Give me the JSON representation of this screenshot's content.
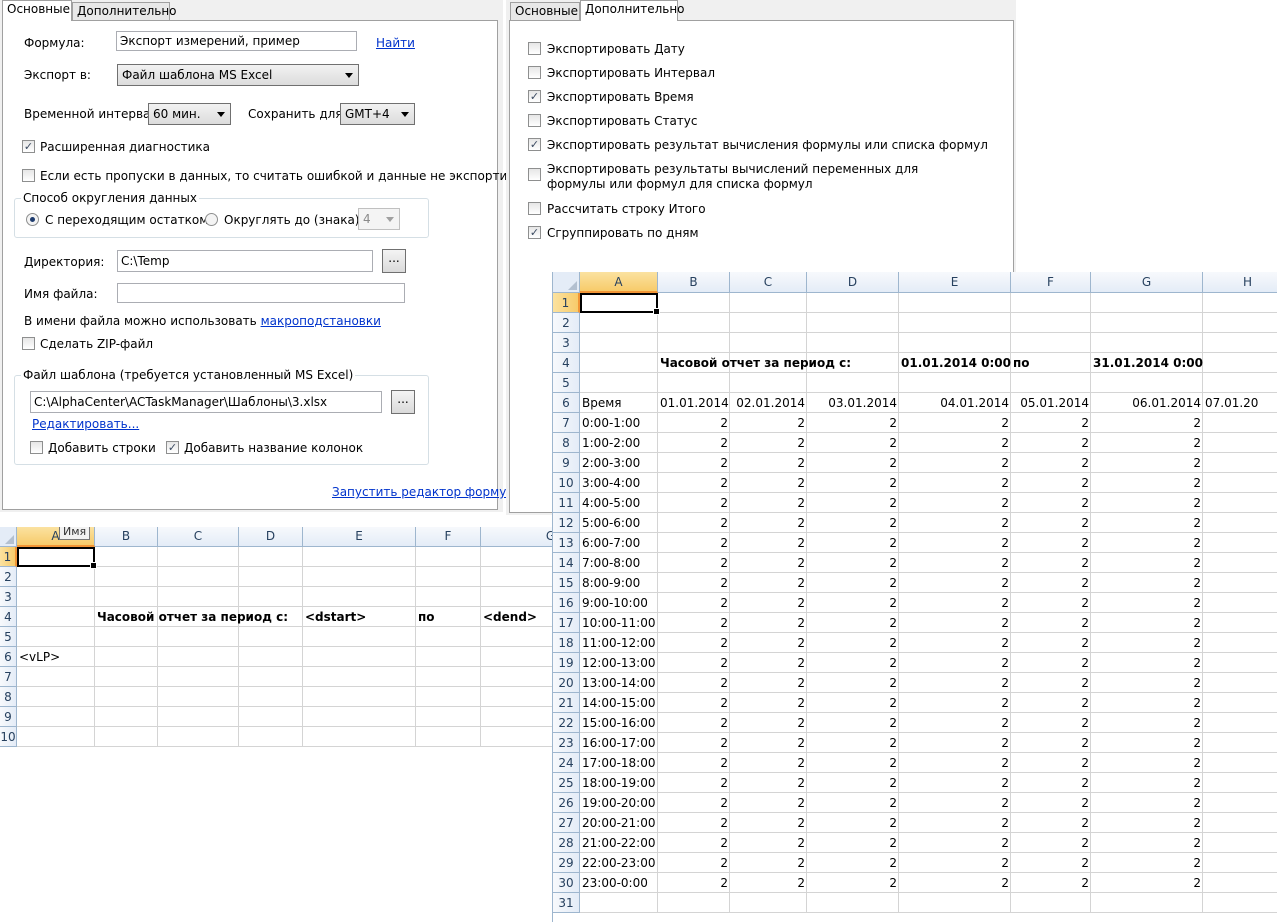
{
  "left_dialog": {
    "tabs": [
      "Основные",
      "Дополнительно"
    ],
    "formula_label": "Формула:",
    "formula_value": "Экспорт измерений, пример",
    "find_link": "Найти",
    "export_label": "Экспорт в:",
    "export_value": "Файл шаблона MS Excel",
    "interval_label": "Временной интервал:",
    "interval_value": "60 мин.",
    "save_for_label": "Сохранить для:",
    "save_for_value": "GMT+4",
    "ext_diag_label": "Расширенная диагностика",
    "ext_diag_checked": true,
    "gaps_label": "Если есть пропуски в данных, то считать ошибкой и данные не экспортировать",
    "gaps_checked": false,
    "rounding_group": "Способ округления данных",
    "rounding_carry_label": "С переходящим остатком",
    "rounding_carry_selected": true,
    "rounding_digits_label": "Округлять до (знака)",
    "rounding_digits_value": "4",
    "dir_label": "Директория:",
    "dir_value": "C:\\Temp",
    "browse_label": "...",
    "filename_label": "Имя файла:",
    "filename_value": "",
    "macro_hint": "В имени файла можно использовать",
    "macro_link": "макроподстановки",
    "zip_label": "Сделать ZIP-файл",
    "zip_checked": false,
    "template_group": "Файл шаблона (требуется установленный MS Excel)",
    "template_path": "C:\\AlphaCenter\\ACTaskManager\\Шаблоны\\3.xlsx",
    "edit_link": "Редактировать...",
    "add_rows_label": "Добавить строки",
    "add_rows_checked": false,
    "add_colnames_label": "Добавить название колонок",
    "add_colnames_checked": true,
    "formula_editor_link": "Запустить редактор формул"
  },
  "right_dialog": {
    "tabs": [
      "Основные",
      "Дополнительно"
    ],
    "options": [
      {
        "label": "Экспортировать Дату",
        "checked": false
      },
      {
        "label": "Экспортировать Интервал",
        "checked": false
      },
      {
        "label": "Экспортировать Время",
        "checked": true
      },
      {
        "label": "Экспортировать Статус",
        "checked": false
      },
      {
        "label": "Экспортировать результат вычисления формулы или списка формул",
        "checked": true
      },
      {
        "label": "Экспортировать результаты вычислений переменных для",
        "label2": "формулы или формул для списка формул",
        "checked": false
      },
      {
        "label": "Рассчитать строку Итого",
        "checked": false
      },
      {
        "label": "Сгруппировать по дням",
        "checked": true
      }
    ]
  },
  "template_sheet": {
    "tooltip": "Имя",
    "columns": [
      "A",
      "B",
      "C",
      "D",
      "E",
      "F",
      "G"
    ],
    "rows": [
      "1",
      "2",
      "3",
      "4",
      "5",
      "6",
      "7",
      "8",
      "9",
      "10"
    ],
    "title": "Часовой отчет за период с:",
    "dstart": "<dstart>",
    "po": "по",
    "dend": "<dend>",
    "vlp": "<vLP>"
  },
  "result_sheet": {
    "columns": [
      "A",
      "B",
      "C",
      "D",
      "E",
      "F",
      "G",
      "H"
    ],
    "title": "Часовой отчет за период с:",
    "date_from": "01.01.2014 0:00",
    "po": "по",
    "date_to": "31.01.2014 0:00",
    "time_header": "Время",
    "dates": [
      "01.01.2014",
      "02.01.2014",
      "03.01.2014",
      "04.01.2014",
      "05.01.2014",
      "06.01.2014",
      "07.01.20"
    ],
    "hours": [
      "0:00-1:00",
      "1:00-2:00",
      "2:00-3:00",
      "3:00-4:00",
      "4:00-5:00",
      "5:00-6:00",
      "6:00-7:00",
      "7:00-8:00",
      "8:00-9:00",
      "9:00-10:00",
      "10:00-11:00",
      "11:00-12:00",
      "12:00-13:00",
      "13:00-14:00",
      "14:00-15:00",
      "15:00-16:00",
      "16:00-17:00",
      "17:00-18:00",
      "18:00-19:00",
      "19:00-20:00",
      "20:00-21:00",
      "21:00-22:00",
      "22:00-23:00",
      "23:00-0:00"
    ],
    "value": "2"
  }
}
